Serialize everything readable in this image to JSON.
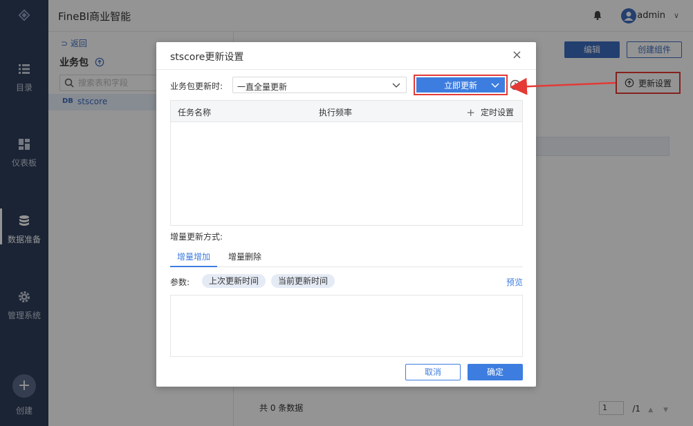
{
  "app": {
    "title": "FineBI商业智能"
  },
  "user": {
    "name": "admin",
    "caret": "∨"
  },
  "sidebar": {
    "items": [
      {
        "label": "目录"
      },
      {
        "label": "仪表板"
      },
      {
        "label": "数据准备"
      },
      {
        "label": "管理系统"
      }
    ],
    "create_label": "创建",
    "create_symbol": "+"
  },
  "left_panel": {
    "back": "⊃ 返回",
    "package_title": "业务包",
    "search_placeholder": "搜索表和字段",
    "tree_badge": "DB",
    "tree_item": "stscore"
  },
  "main": {
    "edit_label": "编辑",
    "create_component_label": "创建组件",
    "update_settings_label": "更新设置",
    "footer_count": "共 0 条数据",
    "page_current": "1",
    "page_total": "/1",
    "page_arrows": "▲ ▼"
  },
  "dialog": {
    "title": "stscore更新设置",
    "close": "×",
    "package_update_label": "业务包更新时:",
    "update_mode": "一直全量更新",
    "update_now_label": "立即更新",
    "table": {
      "col_task": "任务名称",
      "col_freq": "执行频率",
      "add_symbol": "+",
      "add_label": "定时设置"
    },
    "incremental_label": "增量更新方式:",
    "tabs": [
      {
        "label": "增量增加"
      },
      {
        "label": "增量删除"
      }
    ],
    "params_label": "参数:",
    "param_chips": [
      "上次更新时间",
      "当前更新时间"
    ],
    "preview_label": "预览",
    "cancel_label": "取消",
    "ok_label": "确定"
  },
  "colors": {
    "sidebar": "#2f3f5c",
    "primary": "#3d7ddf",
    "highlight": "#e53935"
  }
}
